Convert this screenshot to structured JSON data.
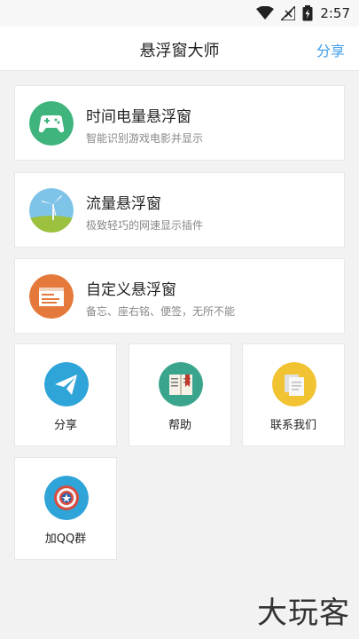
{
  "status_bar": {
    "time": "2:57",
    "icons": [
      "wifi-icon",
      "no-signal-icon",
      "battery-icon"
    ]
  },
  "app_bar": {
    "title": "悬浮窗大师",
    "share_label": "分享"
  },
  "features": [
    {
      "title": "时间电量悬浮窗",
      "subtitle": "智能识别游戏电影并显示",
      "icon": "gamepad-icon",
      "color": "#3fb57d"
    },
    {
      "title": "流量悬浮窗",
      "subtitle": "极致轻巧的网速显示插件",
      "icon": "windmill-icon",
      "color": "#7ec4e8"
    },
    {
      "title": "自定义悬浮窗",
      "subtitle": "备忘、座右铭、便签，无所不能",
      "icon": "window-icon",
      "color": "#e5793b"
    }
  ],
  "tiles": [
    {
      "label": "分享",
      "icon": "paper-plane-icon",
      "color": "#2fa4d8"
    },
    {
      "label": "帮助",
      "icon": "book-icon",
      "color": "#3aa58c"
    },
    {
      "label": "联系我们",
      "icon": "contact-icon",
      "color": "#f1c232"
    },
    {
      "label": "加QQ群",
      "icon": "shield-star-icon",
      "color": "#2fa4d8"
    }
  ],
  "watermark": "大玩客"
}
